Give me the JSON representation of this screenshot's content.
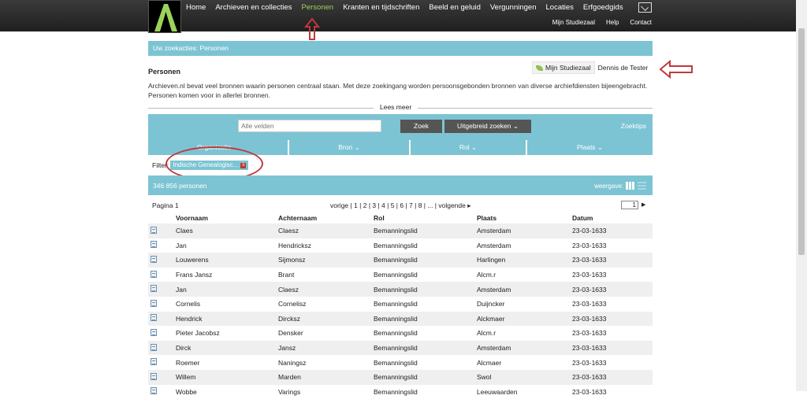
{
  "nav": {
    "items": [
      "Home",
      "Archieven en collecties",
      "Personen",
      "Kranten en tijdschriften",
      "Beeld en geluid",
      "Vergunningen",
      "Locaties",
      "Erfgoedgids"
    ],
    "active": "Personen",
    "sub_items": [
      "Mijn Studiezaal",
      "Help",
      "Contact"
    ]
  },
  "breadcrumb": "Uw zoekacties: Personen",
  "page_title": "Personen",
  "user": {
    "studiezaal": "Mijn Studiezaal",
    "name": "Dennis de Tester"
  },
  "intro": "Archieven.nl bevat veel bronnen waarin personen centraal staan. Met deze zoekingang worden persoonsgebonden bronnen van diverse archiefdiensten bijeengebracht. Personen komen voor in allerlei bronnen.",
  "lees_meer": "Lees meer",
  "search": {
    "placeholder": "Alle velden",
    "zoek": "Zoek",
    "uitgebreid": "Uitgebreid zoeken ⌄",
    "zoektips": "Zoektips"
  },
  "facets": [
    "Organisatie ⌄",
    "Bron ⌄",
    "Rol ⌄",
    "Plaats ⌄"
  ],
  "filter": {
    "label": "Filter:",
    "chip": "Indische Genealogisc...",
    "remove": "x"
  },
  "results": {
    "count": "346 856 personen",
    "weergave": "weergave:"
  },
  "pagination": {
    "label": "Pagina 1",
    "pages": "vorige | 1 | 2 | 3 | 4 | 5 | 6 | 7 | 8 | ... | volgende ▸",
    "current": "1"
  },
  "table": {
    "headers": [
      "Voornaam",
      "Achternaam",
      "Rol",
      "Plaats",
      "Datum"
    ],
    "rows": [
      [
        "Claes",
        "Claesz",
        "Bemanningslid",
        "Amsterdam",
        "23-03-1633"
      ],
      [
        "Jan",
        "Hendricksz",
        "Bemanningslid",
        "Amsterdam",
        "23-03-1633"
      ],
      [
        "Louwerens",
        "Sijmonsz",
        "Bemanningslid",
        "Harlingen",
        "23-03-1633"
      ],
      [
        "Frans Jansz",
        "Brant",
        "Bemanningslid",
        "Alcm.r",
        "23-03-1633"
      ],
      [
        "Jan",
        "Claesz",
        "Bemanningslid",
        "Amsterdam",
        "23-03-1633"
      ],
      [
        "Cornelis",
        "Cornelisz",
        "Bemanningslid",
        "Duijncker",
        "23-03-1633"
      ],
      [
        "Hendrick",
        "Dircksz",
        "Bemanningslid",
        "Alckmaer",
        "23-03-1633"
      ],
      [
        "Pieter Jacobsz",
        "Densker",
        "Bemanningslid",
        "Alcm.r",
        "23-03-1633"
      ],
      [
        "Dirck",
        "Jansz",
        "Bemanningslid",
        "Amsterdam",
        "23-03-1633"
      ],
      [
        "Roemer",
        "Naningsz",
        "Bemanningslid",
        "Alcmaer",
        "23-03-1633"
      ],
      [
        "Willem",
        "Marden",
        "Bemanningslid",
        "Swol",
        "23-03-1633"
      ],
      [
        "Wobbe",
        "Varings",
        "Bemanningslid",
        "Leeuwaarden",
        "23-03-1633"
      ]
    ]
  },
  "colors": {
    "accent": "#7cc4d3",
    "active_nav": "#9bd35a",
    "annotation": "#c0393b"
  }
}
